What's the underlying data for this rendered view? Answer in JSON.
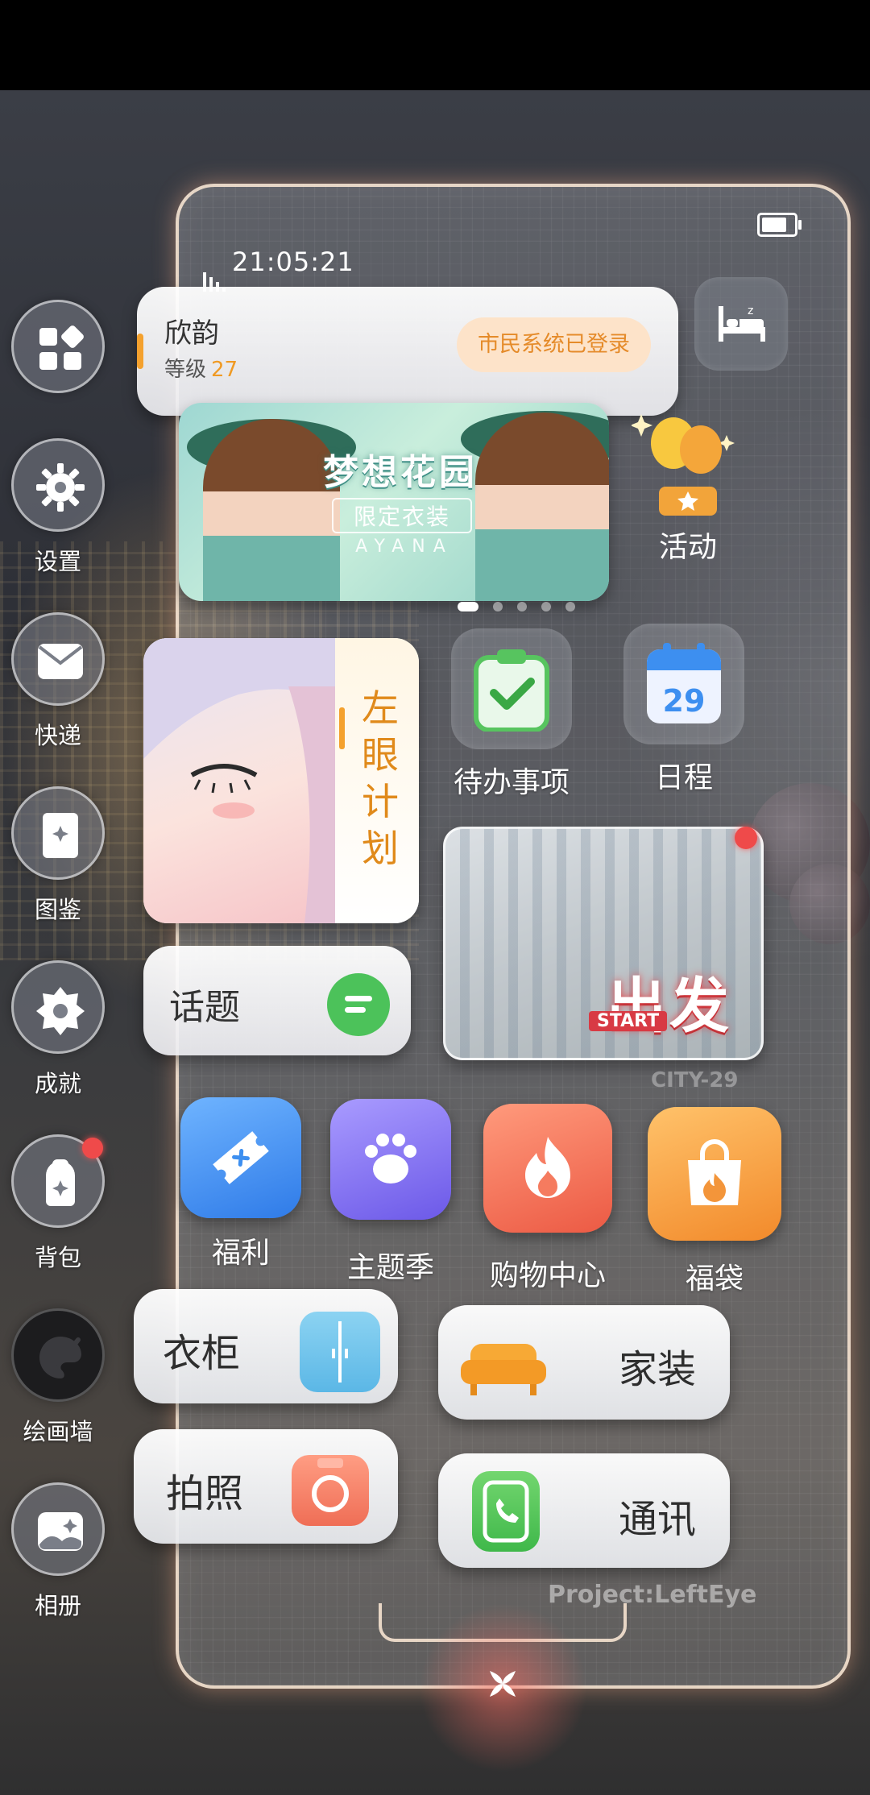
{
  "status_bar": {
    "time": "21:05:21"
  },
  "profile": {
    "name": "欣韵",
    "level_label": "等级",
    "level_value": "27",
    "status": "市民系统已登录"
  },
  "banner": {
    "title": "梦想花园",
    "subtitle": "限定衣装",
    "brand": "AYANA",
    "page_count": 6,
    "active_page": 1
  },
  "activity": {
    "label": "活动"
  },
  "plan_card": {
    "title": "左眼计划"
  },
  "apps_top": [
    {
      "label": "待办事项",
      "icon": "clipboard-check-icon"
    },
    {
      "label": "日程",
      "icon": "calendar-icon",
      "date": "29"
    }
  ],
  "topic": {
    "label": "话题"
  },
  "start_card": {
    "go": "出发",
    "start": "START",
    "watermark": "CITY-29",
    "has_notification": true
  },
  "app_tiles": [
    {
      "label": "福利",
      "icon": "ticket-icon",
      "color": "#3d8ff0"
    },
    {
      "label": "主题季",
      "icon": "paw-icon",
      "color": "#7d6cf0"
    },
    {
      "label": "购物中心",
      "icon": "flame-icon",
      "color": "#f06b52"
    },
    {
      "label": "福袋",
      "icon": "shopping-bag-icon",
      "color": "#f3953a"
    }
  ],
  "pills": [
    {
      "label": "衣柜",
      "icon": "wardrobe-icon"
    },
    {
      "label": "家装",
      "icon": "sofa-icon"
    },
    {
      "label": "拍照",
      "icon": "camera-icon"
    },
    {
      "label": "通讯",
      "icon": "phone-icon"
    }
  ],
  "sidebar": [
    {
      "label": "",
      "icon": "apps-grid-icon"
    },
    {
      "label": "设置",
      "icon": "gear-icon"
    },
    {
      "label": "快递",
      "icon": "mail-icon"
    },
    {
      "label": "图鉴",
      "icon": "book-icon"
    },
    {
      "label": "成就",
      "icon": "medal-icon"
    },
    {
      "label": "背包",
      "icon": "backpack-icon",
      "badge": true
    },
    {
      "label": "绘画墙",
      "icon": "palette-icon"
    },
    {
      "label": "相册",
      "icon": "album-icon"
    }
  ],
  "footer": {
    "project": "Project:LeftEye"
  }
}
